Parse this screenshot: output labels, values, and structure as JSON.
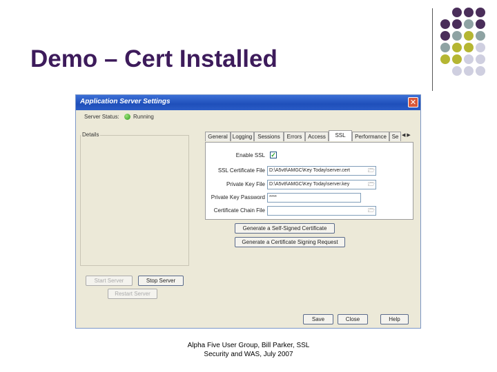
{
  "slide": {
    "title": "Demo – Cert Installed",
    "footer_line1": "Alpha Five User Group, Bill Parker, SSL",
    "footer_line2": "Security and WAS, July 2007"
  },
  "window": {
    "title": "Application Server Settings",
    "close_glyph": "✕",
    "server_status_label": "Server Status:",
    "server_status_value": "Running",
    "details_label": "Details",
    "start_server": "Start Server",
    "stop_server": "Stop Server",
    "restart_server": "Restart Server",
    "save": "Save",
    "close": "Close",
    "help": "Help"
  },
  "tabs": [
    "General",
    "Logging",
    "Sessions",
    "Errors",
    "Access",
    "SSL",
    "Performance",
    "Se"
  ],
  "active_tab": "SSL",
  "ssl": {
    "enable_label": "Enable SSL",
    "enable_checked": "✓",
    "cert_file_label": "SSL Certificate File",
    "cert_file_value": "D:\\A5v8\\AMGC\\Key Today\\server.cert",
    "key_file_label": "Private Key File",
    "key_file_value": "D:\\A5v8\\AMGC\\Key Today\\server.key",
    "password_label": "Private Key Password",
    "password_value": "****",
    "chain_label": "Certificate Chain File",
    "chain_value": "",
    "gen_self_signed": "Generate a Self-Signed Certificate",
    "gen_csr": "Generate a Certificate Signing Request"
  },
  "colors": {
    "title": "#3d1b5b",
    "titlebar": "#1f4fba",
    "dot_purple": "#4a2e5a",
    "dot_teal": "#8ea3a3",
    "dot_olive": "#b5b632",
    "dot_lavender": "#cfcfe0"
  }
}
